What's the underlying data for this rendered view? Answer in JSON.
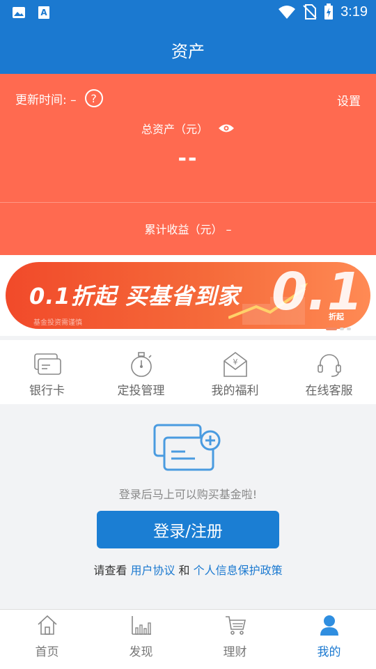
{
  "status_bar": {
    "time": "3:19",
    "icons": [
      "image-icon",
      "text-a-icon",
      "wifi-icon",
      "no-sim-icon",
      "battery-charging-icon"
    ]
  },
  "header": {
    "title": "资产"
  },
  "asset": {
    "update_label": "更新时间: –",
    "help_icon": "?",
    "settings_label": "设置",
    "total_label": "总资产（元）",
    "total_value": "--",
    "cumulative_label": "累计收益（元） –"
  },
  "banner": {
    "headline": "0.1折起  买基省到家",
    "small_text": "基金投资需谨慎",
    "big_number": "0.1",
    "discount_label": "折起"
  },
  "quick_menu": [
    {
      "label": "银行卡",
      "icon": "bank-card-icon"
    },
    {
      "label": "定投管理",
      "icon": "stopwatch-icon"
    },
    {
      "label": "我的福利",
      "icon": "yuan-envelope-icon"
    },
    {
      "label": "在线客服",
      "icon": "headset-icon"
    }
  ],
  "login": {
    "tip": "登录后马上可以购买基金啦!",
    "button_label": "登录/注册",
    "agreement_prefix": "请查看",
    "user_agreement": "用户协议",
    "and": "和",
    "privacy_policy": "个人信息保护政策"
  },
  "tabbar": [
    {
      "label": "首页",
      "icon": "home-icon"
    },
    {
      "label": "发现",
      "icon": "chart-bars-icon"
    },
    {
      "label": "理财",
      "icon": "cart-icon"
    },
    {
      "label": "我的",
      "icon": "user-icon",
      "active": true
    }
  ],
  "colors": {
    "primary": "#1b79d0",
    "asset_bg": "#ff6a50",
    "banner": "#f14a2a"
  }
}
